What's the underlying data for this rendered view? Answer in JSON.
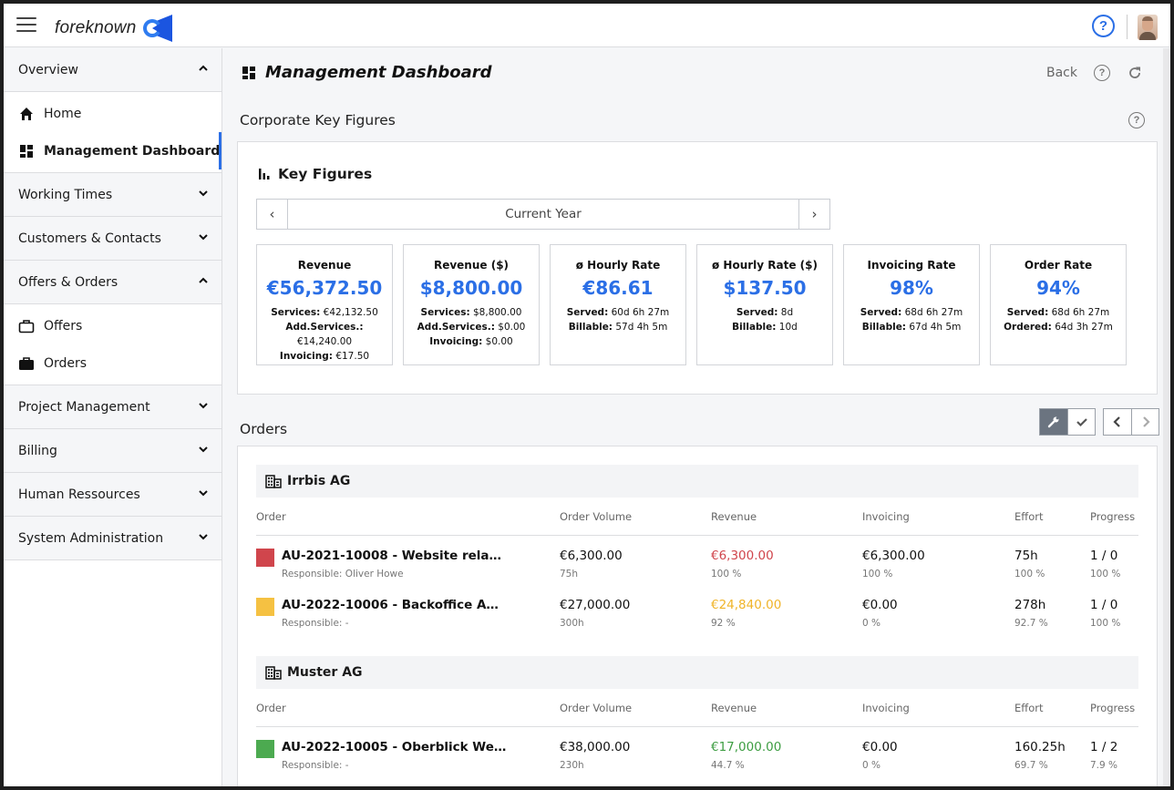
{
  "header": {
    "brand": "foreknown",
    "help_label": "?",
    "menu_icon": "hamburger-icon",
    "avatar_icon": "user-avatar"
  },
  "sidebar": {
    "groups": [
      {
        "label": "Overview",
        "expanded": true,
        "items": [
          {
            "label": "Home",
            "icon": "home-icon",
            "active": false
          },
          {
            "label": "Management Dashboard",
            "icon": "dashboard-icon",
            "active": true
          }
        ]
      },
      {
        "label": "Working Times",
        "expanded": false
      },
      {
        "label": "Customers & Contacts",
        "expanded": false
      },
      {
        "label": "Offers & Orders",
        "expanded": true,
        "items": [
          {
            "label": "Offers",
            "icon": "briefcase-outline-icon",
            "active": false
          },
          {
            "label": "Orders",
            "icon": "briefcase-filled-icon",
            "active": false
          }
        ]
      },
      {
        "label": "Project Management",
        "expanded": false
      },
      {
        "label": "Billing",
        "expanded": false
      },
      {
        "label": "Human Ressources",
        "expanded": false
      },
      {
        "label": "System Administration",
        "expanded": false
      }
    ]
  },
  "page": {
    "title": "Management Dashboard",
    "back_label": "Back",
    "help_label": "?",
    "corporate_section": "Corporate Key Figures",
    "key_figures": {
      "title": "Key Figures",
      "period_label": "Current Year",
      "prev_label": "‹",
      "next_label": "›",
      "tiles": [
        {
          "title": "Revenue",
          "value": "€56,372.50",
          "details": [
            {
              "k": "Services:",
              "v": " €42,132.50"
            },
            {
              "k": "Add.Services.:",
              "v": " €14,240.00"
            },
            {
              "k": "Invoicing:",
              "v": " €17.50"
            }
          ]
        },
        {
          "title": "Revenue ($)",
          "value": "$8,800.00",
          "details": [
            {
              "k": "Services:",
              "v": " $8,800.00"
            },
            {
              "k": "Add.Services.:",
              "v": " $0.00"
            },
            {
              "k": "Invoicing:",
              "v": " $0.00"
            }
          ]
        },
        {
          "title": "ø Hourly Rate",
          "value": "€86.61",
          "details": [
            {
              "k": "Served:",
              "v": " 60d 6h 27m"
            },
            {
              "k": "Billable:",
              "v": " 57d 4h 5m"
            }
          ]
        },
        {
          "title": "ø Hourly Rate ($)",
          "value": "$137.50",
          "details": [
            {
              "k": "Served:",
              "v": " 8d"
            },
            {
              "k": "Billable:",
              "v": " 10d"
            }
          ]
        },
        {
          "title": "Invoicing Rate",
          "value": "98%",
          "details": [
            {
              "k": "Served:",
              "v": " 68d 6h 27m"
            },
            {
              "k": "Billable:",
              "v": " 67d 4h 5m"
            }
          ]
        },
        {
          "title": "Order Rate",
          "value": "94%",
          "details": [
            {
              "k": "Served:",
              "v": " 68d 6h 27m"
            },
            {
              "k": "Ordered:",
              "v": " 64d 3h 27m"
            }
          ]
        }
      ]
    },
    "orders": {
      "title": "Orders",
      "columns": [
        "Order",
        "Order Volume",
        "Revenue",
        "Invoicing",
        "Effort",
        "Progress"
      ],
      "companies": [
        {
          "name": "Irrbis AG",
          "rows": [
            {
              "status_color": "#d0454c",
              "name": "AU-2021-10008 - Website rela…",
              "responsible": "Responsible: Oliver Howe",
              "volume": "€6,300.00",
              "volume_sub": "75h",
              "revenue": "€6,300.00",
              "revenue_sub": "100 %",
              "revenue_color": "#d0454c",
              "invoicing": "€6,300.00",
              "invoicing_sub": "100 %",
              "effort": "75h",
              "effort_sub": "100 %",
              "progress": "1 / 0",
              "progress_sub": "100 %"
            },
            {
              "status_color": "#f5c142",
              "name": "AU-2022-10006 - Backoffice A…",
              "responsible": "Responsible: -",
              "volume": "€27,000.00",
              "volume_sub": "300h",
              "revenue": "€24,840.00",
              "revenue_sub": "92 %",
              "revenue_color": "#f0b429",
              "invoicing": "€0.00",
              "invoicing_sub": "0 %",
              "effort": "278h",
              "effort_sub": "92.7 %",
              "progress": "1 / 0",
              "progress_sub": "100 %"
            }
          ]
        },
        {
          "name": "Muster AG",
          "rows": [
            {
              "status_color": "#4caa50",
              "name": "AU-2022-10005 - Oberblick We…",
              "responsible": "Responsible: -",
              "volume": "€38,000.00",
              "volume_sub": "230h",
              "revenue": "€17,000.00",
              "revenue_sub": "44.7 %",
              "revenue_color": "#3d9d42",
              "invoicing": "€0.00",
              "invoicing_sub": "0 %",
              "effort": "160.25h",
              "effort_sub": "69.7 %",
              "progress": "1 / 2",
              "progress_sub": "7.9 %"
            }
          ]
        }
      ]
    }
  },
  "colors": {
    "accent": "#2b6fe6"
  }
}
